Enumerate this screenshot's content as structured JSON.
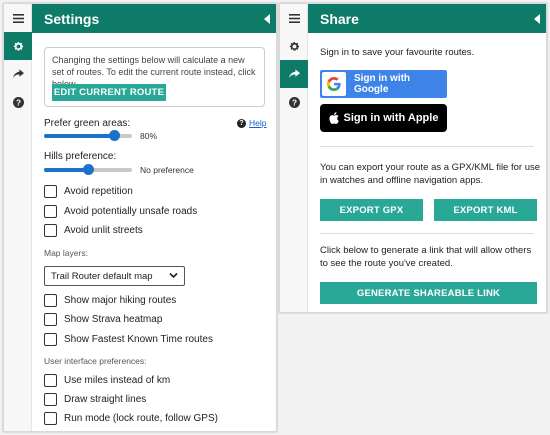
{
  "settings": {
    "title": "Settings",
    "info_text": "Changing the settings below will calculate a new set of routes. To edit the current route instead, click below.",
    "edit_route_label": "EDIT CURRENT ROUTE",
    "green_label": "Prefer green areas:",
    "green_value_text": "80%",
    "green_level": 0.8,
    "help_label": "Help",
    "hills_label": "Hills preference:",
    "hills_value_text": "No preference",
    "hills_level": 0.5,
    "options": [
      "Avoid repetition",
      "Avoid potentially unsafe roads",
      "Avoid unlit streets"
    ],
    "map_layers_label": "Map layers:",
    "map_select_value": "Trail Router default map",
    "layers": [
      "Show major hiking routes",
      "Show Strava heatmap",
      "Show Fastest Known Time routes"
    ],
    "ui_prefs_label": "User interface preferences:",
    "ui_options": [
      "Use miles instead of km",
      "Draw straight lines",
      "Run mode (lock route, follow GPS)"
    ]
  },
  "share": {
    "title": "Share",
    "signin_text": "Sign in to save your favourite routes.",
    "google_label": "Sign in with Google",
    "apple_label": "Sign in with Apple",
    "export_text": "You can export your route as a GPX/KML file for use in watches and offline navigation apps.",
    "export_gpx_label": "EXPORT GPX",
    "export_kml_label": "EXPORT KML",
    "link_text": "Click below to generate a link that will allow others to see the route you've created.",
    "generate_label": "GENERATE SHAREABLE LINK"
  },
  "colors": {
    "header": "#0e7a68",
    "button": "#2aa897",
    "slider": "#1a73c8",
    "google": "#3e84e8",
    "apple": "#000000"
  },
  "icons": {
    "rail": [
      "menu-icon",
      "gear-icon",
      "share-icon",
      "help-icon"
    ]
  }
}
